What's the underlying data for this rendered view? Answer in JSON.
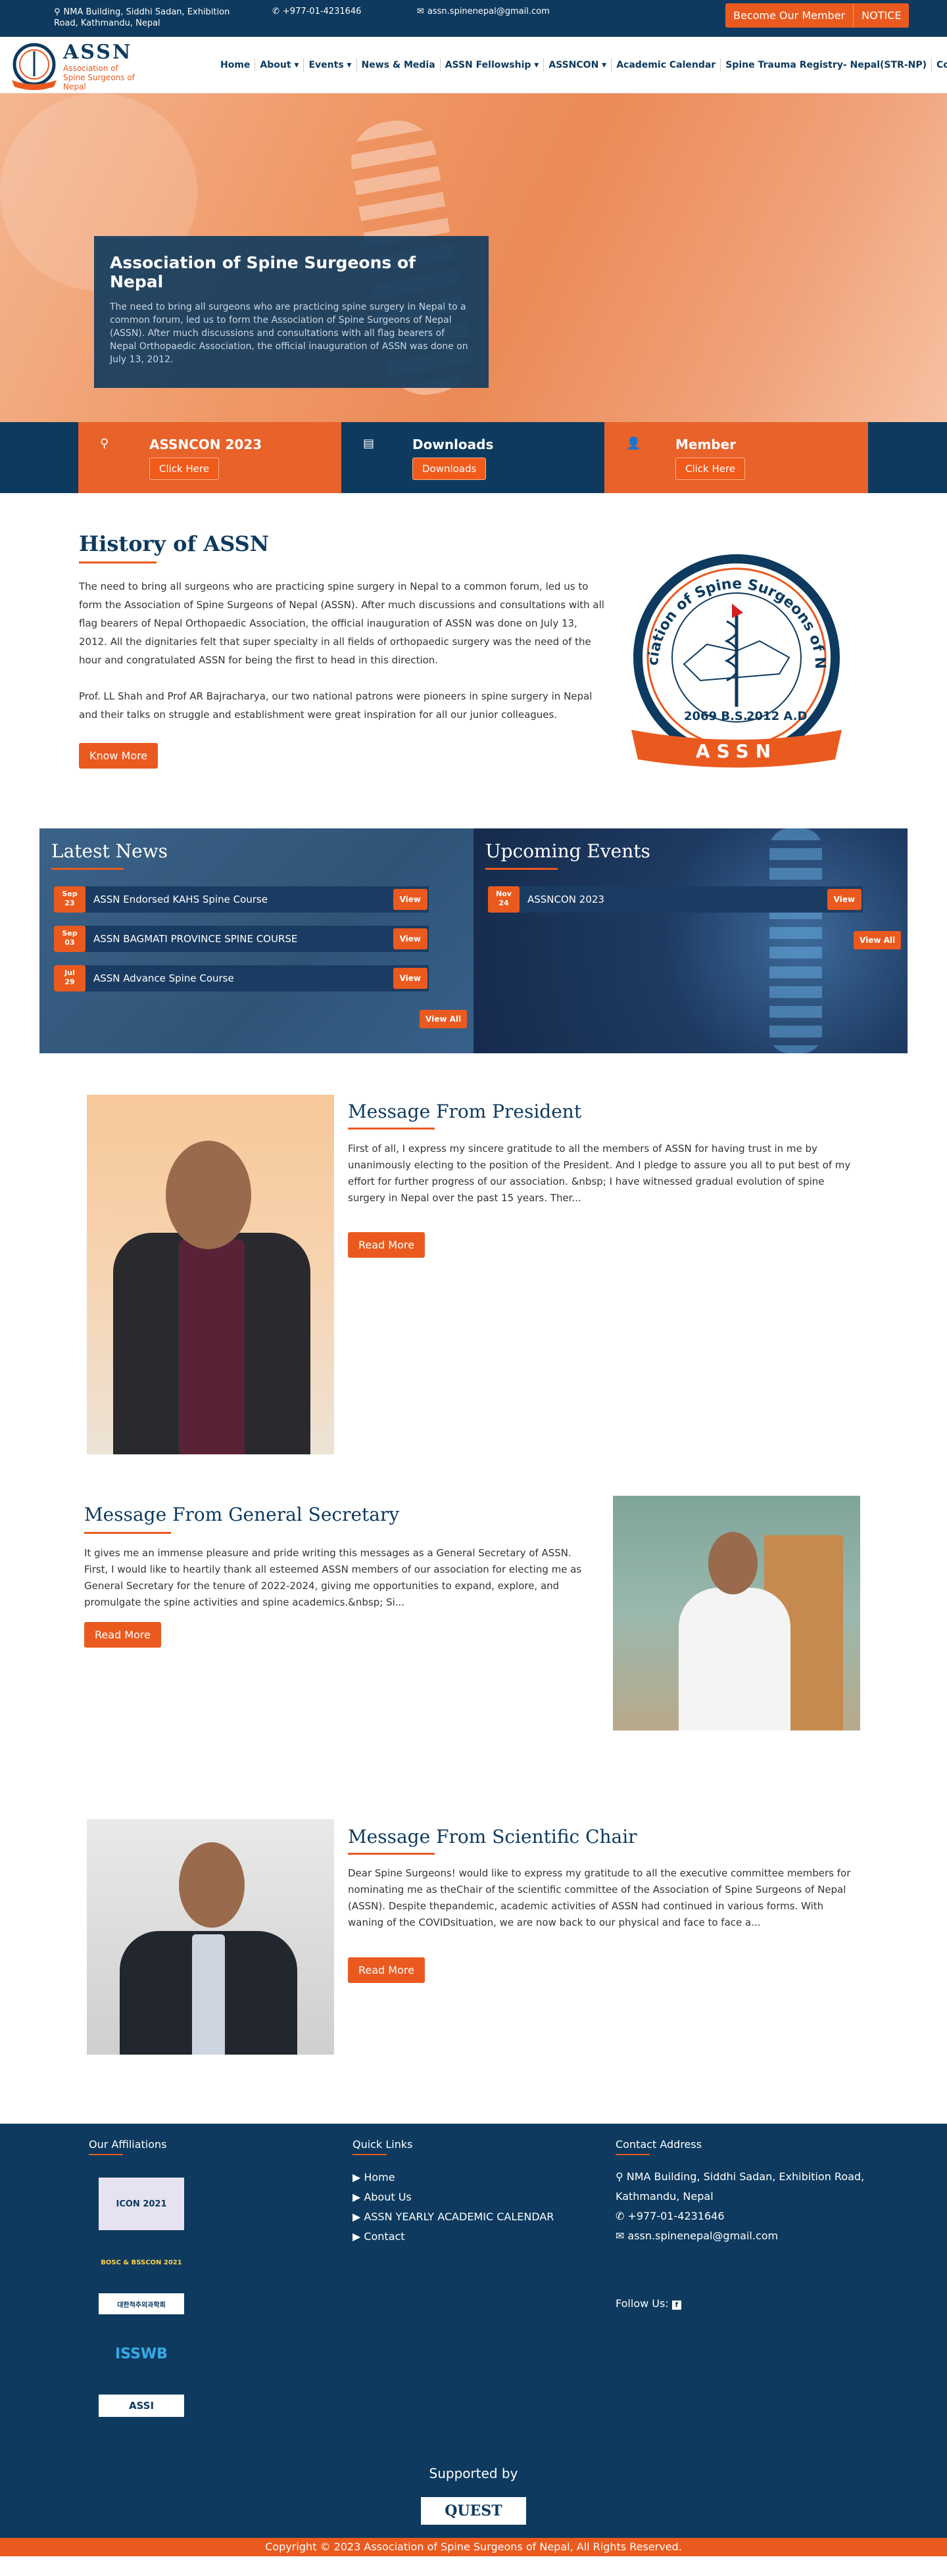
{
  "topbar": {
    "address": "NMA Building, Siddhi Sadan, Exhibition Road, Kathmandu, Nepal",
    "phone": "+977-01-4231646",
    "email": "assn.spinenepal@gmail.com",
    "member_btn": "Become Our Member",
    "notice_btn": "NOTICE"
  },
  "logo": {
    "name": "ASSN",
    "subtitle": "Association of Spine Surgeons of Nepal"
  },
  "nav": [
    "Home",
    "About ▾",
    "Events ▾",
    "News & Media",
    "ASSN Fellowship ▾",
    "ASSNCON ▾",
    "Academic Calendar",
    "Spine Trauma Registry- Nepal(STR-NP)",
    "Contact"
  ],
  "hero": {
    "title": "Association of Spine Surgeons of Nepal",
    "text": "The need to bring all surgeons who are practicing spine surgery in Nepal to a common forum, led us to form the Association of Spine Surgeons of Nepal (ASSN). After much discussions and consultations with all flag bearers of Nepal Orthopaedic Association, the official inauguration of ASSN was done on July 13, 2012."
  },
  "quick": [
    {
      "icon": "search-icon",
      "title": "ASSNCON 2023",
      "button": "Click Here"
    },
    {
      "icon": "id-card-icon",
      "title": "Downloads",
      "button": "Downloads"
    },
    {
      "icon": "user-icon",
      "title": "Member",
      "button": "Click Here"
    }
  ],
  "history": {
    "title": "History of ASSN",
    "p1": "The need to bring all surgeons who are practicing spine surgery in Nepal to a common forum, led us to form the Association of Spine Surgeons of Nepal (ASSN). After much discussions and consultations with all flag bearers of Nepal Orthopaedic Association, the official inauguration of ASSN was done on July 13, 2012. All the dignitaries felt that super specialty in all fields of orthopaedic surgery was the need of the hour and congratulated ASSN for being the first to head in this direction.",
    "p2": "Prof. LL Shah and Prof AR Bajracharya, our two national patrons were pioneers in spine surgery in Nepal and their talks on struggle and establishment were great inspiration for all our junior colleagues.",
    "button": "Know More",
    "emblem": {
      "ring_text": "Association of Spine Surgeons of Nepal",
      "bs": "2069 B.S.",
      "ad": "2012 A.D.",
      "banner": "ASSN"
    }
  },
  "news": {
    "title": "Latest News",
    "items": [
      {
        "month": "Sep",
        "day": "23",
        "title": "ASSN Endorsed KAHS Spine Course",
        "view": "View"
      },
      {
        "month": "Sep",
        "day": "03",
        "title": "ASSN BAGMATI PROVINCE SPINE COURSE",
        "view": "View"
      },
      {
        "month": "Jul",
        "day": "29",
        "title": "ASSN Advance Spine Course",
        "view": "View"
      }
    ],
    "view_all": "View All"
  },
  "events": {
    "title": "Upcoming Events",
    "items": [
      {
        "month": "Nov",
        "day": "24",
        "title": "ASSNCON 2023",
        "view": "View"
      }
    ],
    "view_all": "View All"
  },
  "president": {
    "title": "Message From President",
    "text": "First of all, I express my sincere gratitude to all the members of ASSN for having trust in me by unanimously electing to the position of the President. And I pledge to assure you all to put best of my effort for further progress of our association. &nbsp; I have witnessed gradual evolution of spine surgery in Nepal over the past 15 years. Ther...",
    "button": "Read More"
  },
  "secretary": {
    "title": "Message From General Secretary",
    "text": "It gives me an immense pleasure and pride writing this messages as a General Secretary of ASSN. First, I would like to heartily thank all esteemed ASSN members of our association for electing me as General Secretary for the tenure of 2022-2024, giving me opportunities to expand, explore, and promulgate the spine activities and spine academics.&nbsp; Si...",
    "button": "Read More"
  },
  "scientific": {
    "title": "Message From Scientific Chair",
    "text": "Dear Spine Surgeons! would like to express my gratitude to all the executive committee members for nominating me as theChair of the scientific committee of the Association of Spine Surgeons of Nepal (ASSN). Despite thepandemic, academic activities of ASSN had continued in various forms. With waning of the COVIDsituation, we are now back to our physical and face to face a...",
    "button": "Read More"
  },
  "footer": {
    "affiliations_title": "Our Affiliations",
    "affiliations": [
      "ICON 2021",
      "BOSC & BSSCON 2021",
      "대한척추외과학회",
      "ISSWB",
      "ASSI"
    ],
    "quick_title": "Quick Links",
    "quick_links": [
      "Home",
      "About Us",
      "ASSN YEARLY ACADEMIC CALENDAR",
      "Contact"
    ],
    "contact_title": "Contact Address",
    "contact_address": "NMA Building, Siddhi Sadan, Exhibition Road, Kathmandu, Nepal",
    "contact_phone": "+977-01-4231646",
    "contact_email": "assn.spinenepal@gmail.com",
    "follow": "Follow Us:",
    "supported": "Supported by",
    "sponsor": "QUEST",
    "copyright": "Copyright © 2023 Association of Spine Surgeons of Nepal, All Rights Reserved."
  },
  "colors": {
    "navy": "#0d3a5e",
    "orange": "#ea5a1f"
  }
}
